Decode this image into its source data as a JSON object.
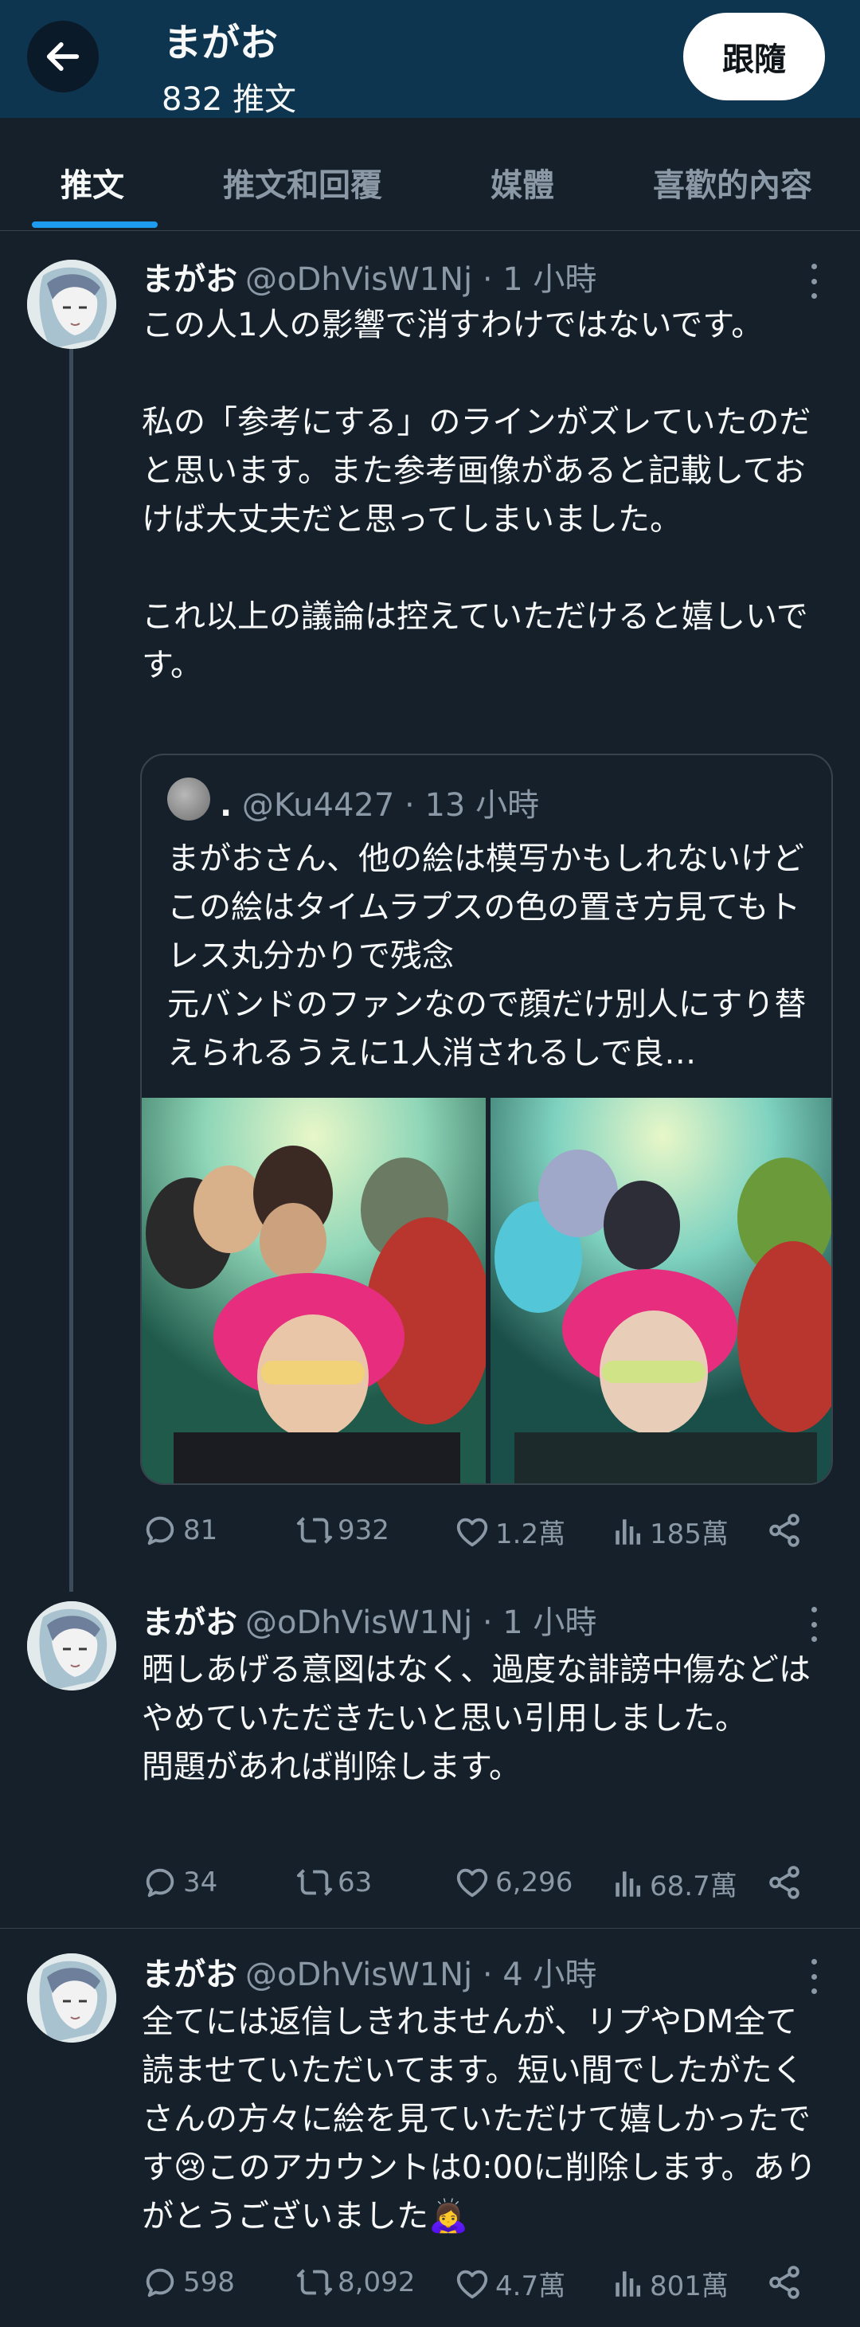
{
  "header": {
    "name": "まがお",
    "tweet_count": "832 推文",
    "follow_label": "跟隨"
  },
  "tabs": [
    {
      "label": "推文",
      "active": true
    },
    {
      "label": "推文和回覆",
      "active": false
    },
    {
      "label": "媒體",
      "active": false
    },
    {
      "label": "喜歡的內容",
      "active": false
    }
  ],
  "tweets": [
    {
      "name": "まがお",
      "handle": "@oDhVisW1Nj",
      "time": "· 1 小時",
      "text": "この人1人の影響で消すわけではないです。\n\n私の「参考にする」のラインがズレていたのだと思います。また参考画像があると記載しておけば大丈夫だと思ってしまいました。\n\nこれ以上の議論は控えていただけると嬉しいです。",
      "quote": {
        "name": ".",
        "handle": "@Ku4427",
        "time": "· 13 小時",
        "text": "まがおさん、他の絵は模写かもしれないけどこの絵はタイムラプスの色の置き方見てもトレス丸分かりで残念\n元バンドのファンなので顔だけ別人にすり替えられるうえに1人消されるしで良…"
      },
      "stats": {
        "replies": "81",
        "retweets": "932",
        "likes": "1.2萬",
        "views": "185萬"
      }
    },
    {
      "name": "まがお",
      "handle": "@oDhVisW1Nj",
      "time": "· 1 小時",
      "text": "晒しあげる意図はなく、過度な誹謗中傷などはやめていただきたいと思い引用しました。\n問題があれば削除します。",
      "stats": {
        "replies": "34",
        "retweets": "63",
        "likes": "6,296",
        "views": "68.7萬"
      }
    },
    {
      "name": "まがお",
      "handle": "@oDhVisW1Nj",
      "time": "· 4 小時",
      "text": "全てには返信しきれませんが、リプやDM全て読ませていただいてます。短い間でしたがたくさんの方々に絵を見ていただけて嬉しかったです😢このアカウントは0:00に削除します。ありがとうございました🙇‍♀️",
      "stats": {
        "replies": "598",
        "retweets": "8,092",
        "likes": "4.7萬",
        "views": "801萬"
      }
    }
  ],
  "colors": {
    "background": "#15202b",
    "header": "#0e3550",
    "accent": "#1d9bf0",
    "muted": "#8b98a5"
  }
}
